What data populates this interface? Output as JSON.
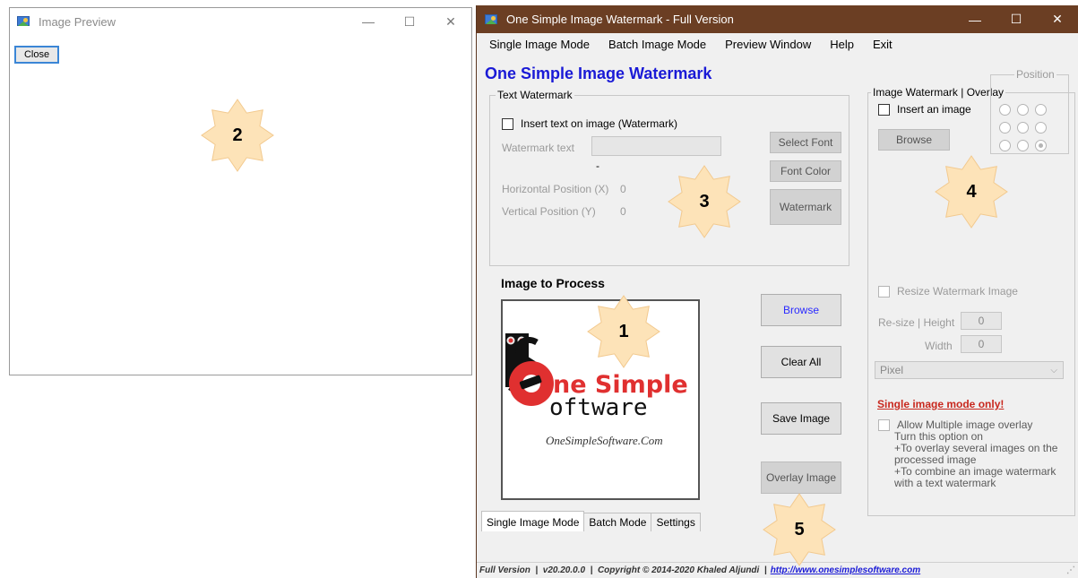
{
  "preview_window": {
    "title": "Image Preview",
    "close_button": "Close"
  },
  "main_window": {
    "title": "One Simple Image Watermark - Full Version",
    "window_controls": {
      "minimize": "—",
      "maximize": "☐",
      "close": "✕"
    },
    "menu": [
      "Single Image Mode",
      "Batch Image Mode",
      "Preview Window",
      "Help",
      "Exit"
    ],
    "heading": "One Simple Image Watermark"
  },
  "text_watermark": {
    "group_title": "Text Watermark",
    "insert_checkbox_label": "Insert text on image (Watermark)",
    "watermark_text_label": "Watermark text",
    "watermark_text_value": "",
    "dash": "-",
    "horizontal_label": "Horizontal Position (X)",
    "horizontal_value": "0",
    "vertical_label": "Vertical Position (Y)",
    "vertical_value": "0",
    "select_font_button": "Select Font",
    "font_color_button": "Font Color",
    "watermark_button": "Watermark"
  },
  "image_to_process": {
    "label": "Image to Process",
    "logo_line1": "ne Simple",
    "logo_line2": "oftware",
    "logo_url": "OneSimpleSoftware.Com",
    "buttons": {
      "browse": "Browse",
      "clear_all": "Clear All",
      "save_image": "Save Image",
      "overlay_image": "Overlay Image"
    }
  },
  "image_watermark": {
    "group_title": "Image Watermark | Overlay",
    "insert_checkbox_label": "Insert an image",
    "browse_button": "Browse",
    "position_title": "Position",
    "position_selected_index": 8,
    "resize_checkbox_label": "Resize Watermark Image",
    "resize_height_label": "Re-size | Height",
    "resize_height_value": "0",
    "resize_width_label": "Width",
    "resize_width_value": "0",
    "unit_dropdown_value": "Pixel",
    "single_mode_note": "Single image mode only!",
    "multi_overlay_label": "Allow Multiple image overlay",
    "multi_overlay_desc": [
      "Turn this option on",
      "+To overlay several images on the processed image",
      "+To combine an image watermark with a text watermark"
    ]
  },
  "tabs": [
    "Single Image Mode",
    "Batch Mode",
    "Settings"
  ],
  "status_bar": {
    "text": "Full Version  |  v20.20.0.0  |  Copyright © 2014-2020 Khaled Aljundi  |",
    "link": "http://www.onesimplesoftware.com"
  },
  "callouts": [
    "1",
    "2",
    "3",
    "4",
    "5"
  ],
  "colors": {
    "titlebar": "#6b3e23",
    "heading": "#1a1ad6",
    "callout_fill": "#fde3b8",
    "note_red": "#c8281e"
  }
}
